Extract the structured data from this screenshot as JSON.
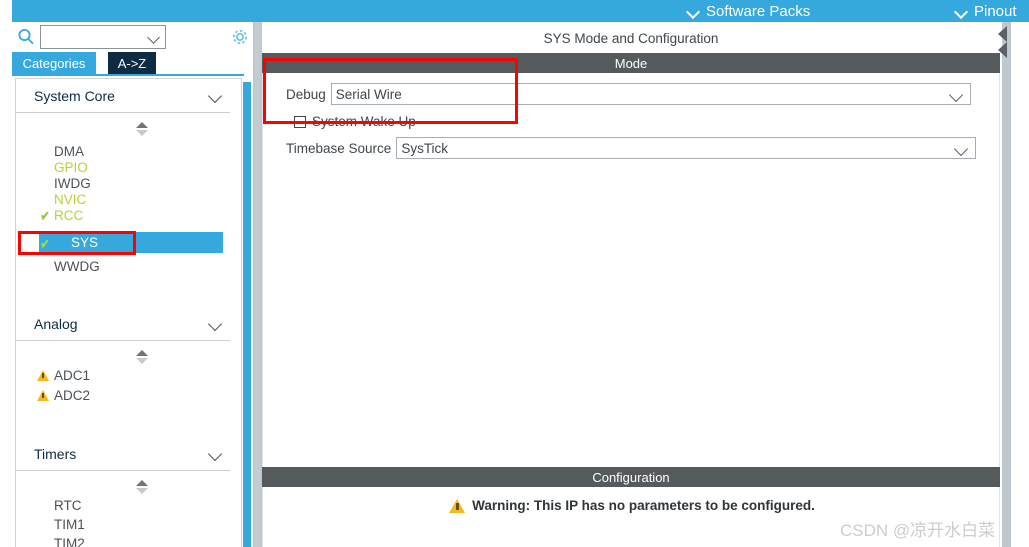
{
  "topbar": {
    "software_packs": "Software Packs",
    "pinout": "Pinout",
    "chevron_icon": "chevron-down-icon"
  },
  "left": {
    "search": {
      "value": "",
      "placeholder": ""
    },
    "gear_icon": "gear-icon",
    "search_icon": "search-icon",
    "tabs": [
      {
        "label": "Categories",
        "active": true
      },
      {
        "label": "A->Z",
        "active": false
      }
    ],
    "groups": [
      {
        "title": "System Core",
        "items": [
          {
            "label": "DMA",
            "state": "plain"
          },
          {
            "label": "GPIO",
            "state": "green"
          },
          {
            "label": "IWDG",
            "state": "plain"
          },
          {
            "label": "NVIC",
            "state": "green"
          },
          {
            "label": "RCC",
            "state": "green",
            "mark": "check"
          },
          {
            "label": "SYS",
            "state": "selected",
            "mark": "check"
          },
          {
            "label": "WWDG",
            "state": "plain"
          }
        ]
      },
      {
        "title": "Analog",
        "items": [
          {
            "label": "ADC1",
            "state": "plain",
            "mark": "warning"
          },
          {
            "label": "ADC2",
            "state": "plain",
            "mark": "warning"
          }
        ]
      },
      {
        "title": "Timers",
        "items": [
          {
            "label": "RTC",
            "state": "plain"
          },
          {
            "label": "TIM1",
            "state": "plain"
          },
          {
            "label": "TIM2",
            "state": "plain"
          }
        ]
      }
    ]
  },
  "right": {
    "panel_title": "SYS Mode and Configuration",
    "mode_header": "Mode",
    "config_header": "Configuration",
    "collapse_icon": "collapse-panel-arrow-icon",
    "debug": {
      "label": "Debug",
      "value": "Serial Wire"
    },
    "system_wake_up": {
      "label": "System Wake Up",
      "checked": false
    },
    "timebase": {
      "label": "Timebase Source",
      "value": "SysTick"
    },
    "warning": {
      "icon": "warning-triangle-icon",
      "text": "Warning: This IP has no parameters to be configured."
    }
  },
  "watermark": "CSDN @凉开水白菜",
  "colors": {
    "accent_blue": "#35a8dd",
    "dark_navy": "#0d2b43",
    "header_gray": "#555a5d",
    "green_text": "#b6d235",
    "warning_amber": "#f5b821",
    "annotation_red": "#fe0000"
  }
}
